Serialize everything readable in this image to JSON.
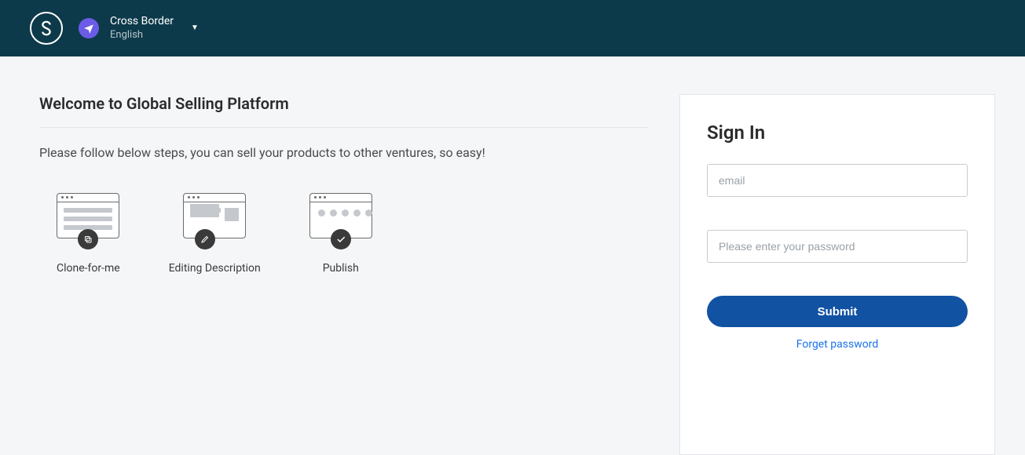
{
  "header": {
    "locale_title": "Cross Border",
    "locale_language": "English"
  },
  "welcome": {
    "title": "Welcome to Global Selling Platform",
    "subtitle": "Please follow below steps, you can sell your products to other ventures, so easy!"
  },
  "steps": [
    {
      "label": "Clone-for-me"
    },
    {
      "label": "Editing Description"
    },
    {
      "label": "Publish"
    }
  ],
  "signin": {
    "title": "Sign In",
    "email_placeholder": "email",
    "password_placeholder": "Please enter your password",
    "submit_label": "Submit",
    "forget_label": "Forget password"
  }
}
